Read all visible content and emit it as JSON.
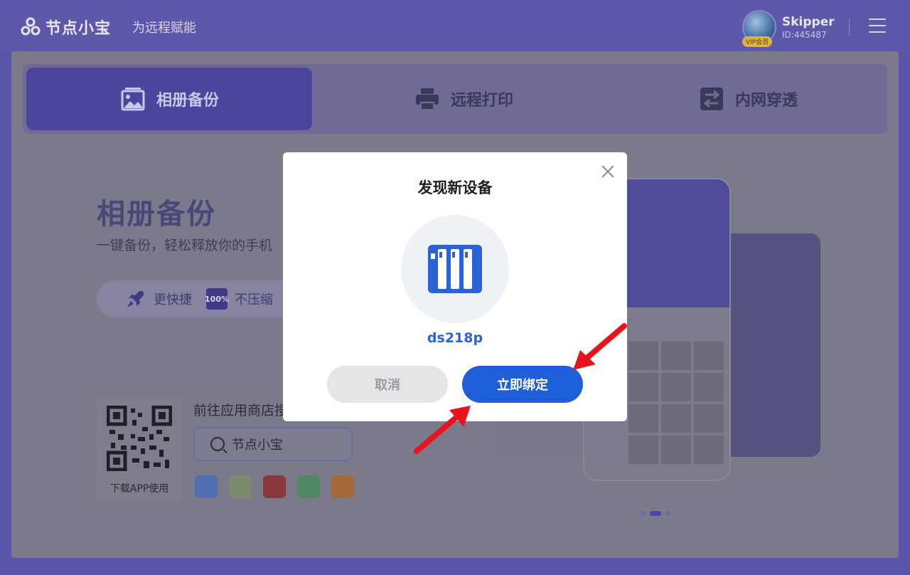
{
  "app": {
    "name": "节点小宝",
    "slogan": "为远程赋能"
  },
  "user": {
    "name": "Skipper",
    "id": "ID:445487",
    "badge": "VIP会员"
  },
  "tabs": [
    {
      "label": "相册备份",
      "icon": "photo-album-icon",
      "active": true
    },
    {
      "label": "远程打印",
      "icon": "printer-icon",
      "active": false
    },
    {
      "label": "内网穿透",
      "icon": "network-tunnel-icon",
      "active": false
    }
  ],
  "main": {
    "title": "相册备份",
    "subtitle": "一键备份，轻松释放你的手机",
    "features": [
      {
        "label": "更快捷",
        "icon": "rocket-icon"
      },
      {
        "label": "不压缩",
        "icon": "100-percent-icon",
        "icon_text": "100%"
      }
    ],
    "qr_caption": "下载APP使用",
    "store_title": "前往应用商店搜",
    "store_search": "节点小宝",
    "stores": [
      "app-store-icon",
      "qq-store-icon",
      "huawei-store-icon",
      "android-store-icon",
      "xiaomi-store-icon"
    ]
  },
  "modal": {
    "title": "发现新设备",
    "device_name": "ds218p",
    "cancel_label": "取消",
    "bind_label": "立即绑定"
  },
  "colors": {
    "brand": "#5d58aa",
    "primary_button": "#1f5ed9",
    "device_icon": "#2b62d6",
    "annotation_arrow": "#e8141b"
  }
}
